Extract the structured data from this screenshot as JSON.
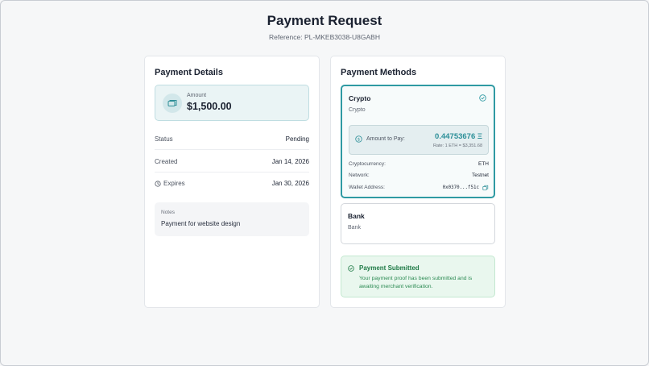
{
  "header": {
    "title": "Payment Request",
    "reference": "Reference: PL-MKEB3038-U8GABH"
  },
  "details": {
    "title": "Payment Details",
    "amount_label": "Amount",
    "amount_value": "$1,500.00",
    "rows": [
      {
        "label": "Status",
        "value": "Pending"
      },
      {
        "label": "Created",
        "value": "Jan 14, 2026"
      },
      {
        "label": "Expires",
        "value": "Jan 30, 2026"
      }
    ],
    "notes_label": "Notes",
    "notes_text": "Payment for website design"
  },
  "methods": {
    "title": "Payment Methods",
    "crypto": {
      "name": "Crypto",
      "sub": "Crypto",
      "pay_label": "Amount to Pay:",
      "pay_amount": "0.44753676 Ξ",
      "pay_rate": "Rate: 1 ETH = $3,351.68",
      "rows": [
        {
          "label": "Cryptocurrency:",
          "value": "ETH"
        },
        {
          "label": "Network:",
          "value": "Testnet"
        },
        {
          "label": "Wallet Address:",
          "value": "0x0370...f51c"
        }
      ]
    },
    "bank": {
      "name": "Bank",
      "sub": "Bank"
    }
  },
  "submitted": {
    "title": "Payment Submitted",
    "text": "Your payment proof has been submitted and is awaiting merchant verification."
  },
  "colors": {
    "accent": "#2f9aa3",
    "success": "#1e7a46",
    "background": "#f6f7f8"
  }
}
